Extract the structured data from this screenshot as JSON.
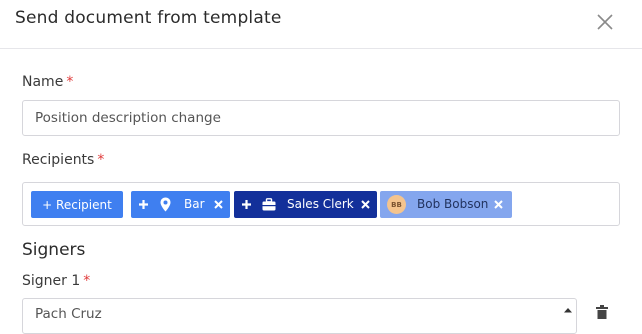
{
  "modal": {
    "title": "Send document from template"
  },
  "name_field": {
    "label": "Name",
    "required_mark": "*",
    "value": "Position description change"
  },
  "recipients_field": {
    "label": "Recipients",
    "required_mark": "*",
    "add_button_label": "+ Recipient",
    "chips": [
      {
        "label": "Bar",
        "icon": "map-pin-icon",
        "color": "#3f7ff0"
      },
      {
        "label": "Sales Clerk",
        "icon": "briefcase-icon",
        "color": "#13309a"
      },
      {
        "label": "Bob Bobson",
        "avatar_initials": "BB",
        "color": "#84a6ee"
      }
    ]
  },
  "signers": {
    "section_title": "Signers",
    "items": [
      {
        "label": "Signer 1",
        "required_mark": "*",
        "selected_value": "Pach Cruz"
      }
    ]
  }
}
